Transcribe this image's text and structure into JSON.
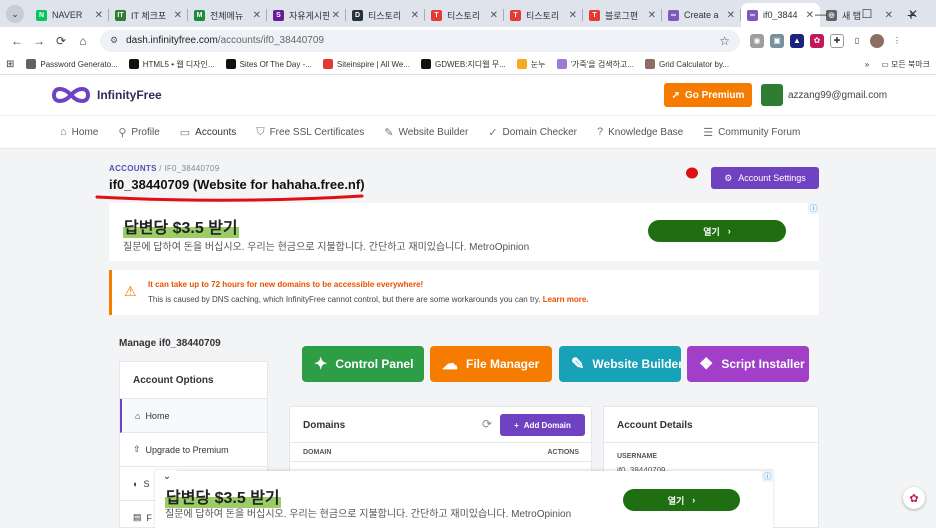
{
  "browser": {
    "tabs": [
      {
        "title": "NAVER",
        "color": "#03c75a",
        "glyph": "N"
      },
      {
        "title": "IT 체크포",
        "color": "#2e7d32",
        "glyph": "IT"
      },
      {
        "title": "전체메뉴",
        "color": "#1b8e3a",
        "glyph": "M"
      },
      {
        "title": "자유게시판",
        "color": "#6a1b9a",
        "glyph": "S"
      },
      {
        "title": "티스토리",
        "color": "#263238",
        "glyph": "D"
      },
      {
        "title": "티스토리",
        "color": "#e53935",
        "glyph": "T"
      },
      {
        "title": "티스토리",
        "color": "#e53935",
        "glyph": "T"
      },
      {
        "title": "블로그편",
        "color": "#e53935",
        "glyph": "T"
      },
      {
        "title": "Create a",
        "color": "#7e57c2",
        "glyph": "∞"
      },
      {
        "title": "if0_3844",
        "color": "#7e57c2",
        "glyph": "∞",
        "active": true
      },
      {
        "title": "새 탭",
        "color": "#5f6368",
        "glyph": "◎"
      }
    ],
    "new_tab": "+",
    "window_controls": [
      "—",
      "☐",
      "✕"
    ],
    "nav_icons": [
      "←",
      "→",
      "⟳",
      "⌂"
    ],
    "url_host": "dash.infinityfree.com",
    "url_path": "/accounts/if0_38440709",
    "star_icon": "☆",
    "bookmarks": [
      {
        "label": "Password Generato...",
        "color": "#5f6368"
      },
      {
        "label": "HTML5 • 웹 디자인...",
        "color": "#111111"
      },
      {
        "label": "Sites Of The Day -...",
        "color": "#111111"
      },
      {
        "label": "Siteinspire | All We...",
        "color": "#e53935"
      },
      {
        "label": "GDWEB:지디웹 무...",
        "color": "#111111"
      },
      {
        "label": "눈누",
        "color": "#f9a825"
      },
      {
        "label": "'가죽'을 검색하고...",
        "color": "#9c7bd6"
      },
      {
        "label": "Grid Calculator by...",
        "color": "#8d6e63"
      }
    ],
    "bookmarks_more": "»",
    "all_bookmarks": "모든 북마크"
  },
  "header": {
    "brand": "InfinityFree",
    "go_premium": "Go Premium",
    "email": "azzang99@gmail.com"
  },
  "nav": [
    {
      "label": "Home",
      "icon": "⌂"
    },
    {
      "label": "Profile",
      "icon": "⚲"
    },
    {
      "label": "Accounts",
      "icon": "▭",
      "active": true
    },
    {
      "label": "Free SSL Certificates",
      "icon": "⛉"
    },
    {
      "label": "Website Builder",
      "icon": "✎"
    },
    {
      "label": "Domain Checker",
      "icon": "✓"
    },
    {
      "label": "Knowledge Base",
      "icon": "?"
    },
    {
      "label": "Community Forum",
      "icon": "☰"
    }
  ],
  "breadcrumb": {
    "root": "ACCOUNTS",
    "sep": "/",
    "current": "IF0_38440709"
  },
  "page_title": "if0_38440709 (Website for hahaha.free.nf)",
  "account_settings": "Account Settings",
  "ad1": {
    "headline": "답변당 $3.5 받기",
    "sub": "질문에 답하여 돈을 버십시오. 우리는 현금으로 지불합니다. 간단하고 재미있습니다. MetroOpinion",
    "button": "열기",
    "chevron": "›",
    "info": "ⓘ"
  },
  "alert": {
    "title": "It can take up to 72 hours for new domains to be accessible everywhere!",
    "body": "This is caused by DNS caching, which InfinityFree cannot control, but there are some workarounds you can try.",
    "link": "Learn more."
  },
  "manage_title": "Manage if0_38440709",
  "account_options": {
    "title": "Account Options",
    "items": [
      {
        "label": "Home",
        "icon": "⌂"
      },
      {
        "label": "Upgrade to Premium",
        "icon": "⇧"
      },
      {
        "label": "S",
        "icon": "◐"
      },
      {
        "label": "F",
        "icon": "▤"
      }
    ]
  },
  "tiles": [
    {
      "label": "Control Panel",
      "icon": "✦",
      "color": "#2e9e46"
    },
    {
      "label": "File Manager",
      "icon": "☁",
      "color": "#f57c00"
    },
    {
      "label": "Website Builder",
      "icon": "✎",
      "color": "#17a2b8"
    },
    {
      "label": "Script Installer",
      "icon": "❖",
      "color": "#a23fc9"
    }
  ],
  "domains": {
    "title": "Domains",
    "refresh_icon": "⟳",
    "add": "Add Domain",
    "add_icon": "+",
    "col_domain": "DOMAIN",
    "col_actions": "ACTIONS"
  },
  "account_details": {
    "title": "Account Details",
    "username_label": "USERNAME",
    "username_value": "if0_38440709"
  },
  "ad2": {
    "headline": "답변당 $3.5 받기",
    "sub": "질문에 답하여 돈을 버십시오. 우리는 현금으로 지불합니다. 간단하고 재미있습니다. MetroOpinion",
    "button": "열기",
    "chevron": "›",
    "info": "ⓘ",
    "close": "⌄"
  }
}
